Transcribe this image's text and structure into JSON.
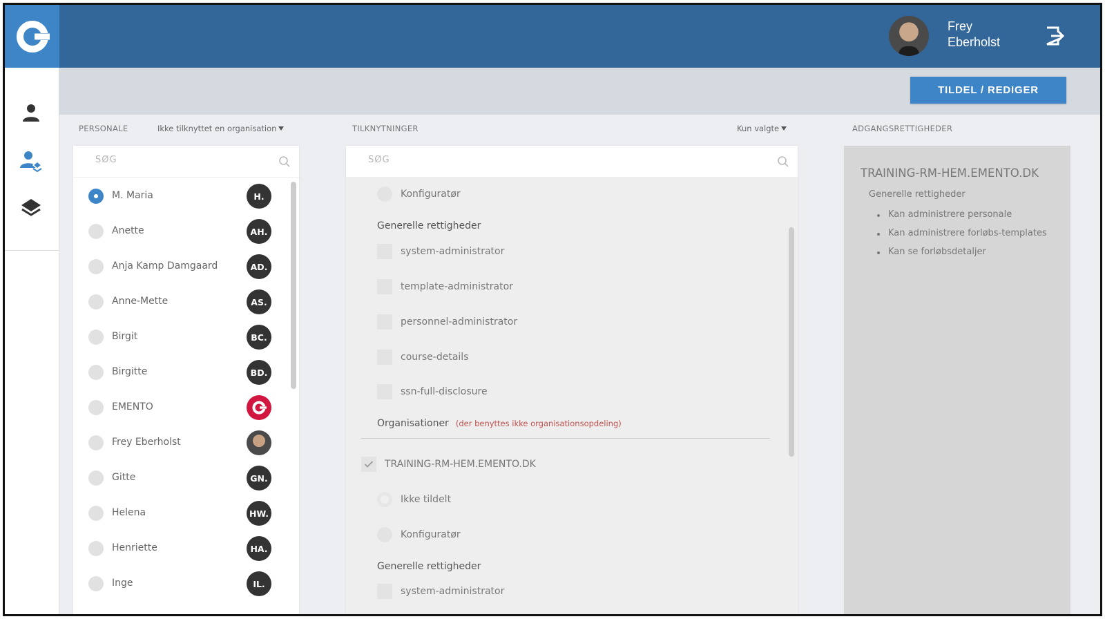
{
  "header": {
    "user_first": "Frey",
    "user_last": "Eberholst"
  },
  "toolbar": {
    "assign_label": "TILDEL / REDIGER"
  },
  "personale": {
    "heading": "PERSONALE",
    "filter_label": "Ikke tilknyttet en organisation",
    "search_placeholder": "SØG",
    "people": [
      {
        "name": "M. Maria",
        "badge": "H.",
        "selected": true
      },
      {
        "name": "Anette",
        "badge": "AH."
      },
      {
        "name": "Anja Kamp Damgaard",
        "badge": "AD."
      },
      {
        "name": "Anne-Mette",
        "badge": "AS."
      },
      {
        "name": "Birgit",
        "badge": "BC."
      },
      {
        "name": "Birgitte",
        "badge": "BD."
      },
      {
        "name": "EMENTO",
        "badge": ""
      },
      {
        "name": "Frey Eberholst",
        "badge": ""
      },
      {
        "name": "Gitte",
        "badge": "GN."
      },
      {
        "name": "Helena",
        "badge": "HW."
      },
      {
        "name": "Henriette",
        "badge": "HA."
      },
      {
        "name": "Inge",
        "badge": "IL."
      }
    ]
  },
  "tilknytninger": {
    "heading": "TILKNYTNINGER",
    "filter_label": "Kun valgte",
    "search_placeholder": "SØG",
    "top_radio": "Konfiguratør",
    "section1": "Generelle rettigheder",
    "rights": [
      "system-administrator",
      "template-administrator",
      "personnel-administrator",
      "course-details",
      "ssn-full-disclosure"
    ],
    "org_section": "Organisationer",
    "org_note": "(der benyttes ikke organisationsopdeling)",
    "org_name": "TRAINING-RM-HEM.EMENTO.DK",
    "org_radio1": "Ikke tildelt",
    "org_radio2": "Konfiguratør",
    "section2": "Generelle rettigheder",
    "rights2_first": "system-administrator"
  },
  "adgang": {
    "heading": "ADGANGSRETTIGHEDER",
    "org": "TRAINING-RM-HEM.EMENTO.DK",
    "sub": "Generelle rettigheder",
    "items": [
      "Kan administrere personale",
      "Kan administrere forløbs-templates",
      "Kan se forløbsdetaljer"
    ]
  }
}
